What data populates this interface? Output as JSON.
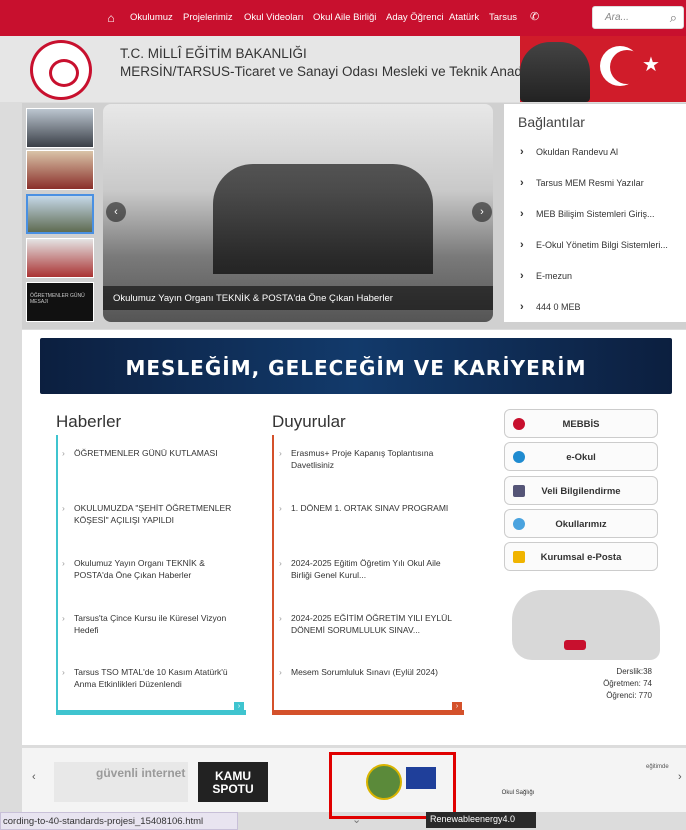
{
  "nav": {
    "home_icon": "home-icon",
    "items": [
      "Okulumuz",
      "Projelerimiz",
      "Okul Videoları",
      "Okul Aile Birliği",
      "Aday Öğrenci",
      "Atatürk",
      "Tarsus"
    ],
    "phone_icon": "phone-icon",
    "search_placeholder": "Ara...",
    "search_icon": "search-icon"
  },
  "header": {
    "title_line1": "T.C. MİLLÎ EĞİTİM BAKANLIĞI",
    "title_line2": "MERSİN/TARSUS-Ticaret ve Sanayi Odası Mesleki ve Teknik Anadolu Lisesi"
  },
  "slider": {
    "caption": "Okulumuz Yayın Organı TEKNİK & POSTA'da Öne Çıkan Haberler",
    "thumb5_text": "ÖĞRETMENLER GÜNÜ MESAJI"
  },
  "links": {
    "title": "Bağlantılar",
    "items": [
      "Okuldan Randevu Al",
      "Tarsus MEM Resmi Yazılar",
      "MEB Bilişim Sistemleri Giriş...",
      "E-Okul Yönetim Bilgi Sistemleri...",
      "E-mezun",
      "444 0 MEB"
    ]
  },
  "banner": {
    "text": "MESLEĞİM, GELECEĞİM VE KARİYERİM"
  },
  "haberler": {
    "title": "Haberler",
    "items": [
      "ÖĞRETMENLER GÜNÜ KUTLAMASI",
      "OKULUMUZDA \"ŞEHİT ÖĞRETMENLER KÖŞESİ\" AÇILIŞI YAPILDI",
      "Okulumuz Yayın Organı TEKNİK & POSTA'da Öne Çıkan Haberler",
      "Tarsus'ta Çince Kursu ile Küresel Vizyon Hedefi",
      "Tarsus TSO MTAL'de 10 Kasım Atatürk'ü Anma Etkinlikleri Düzenlendi"
    ]
  },
  "duyurular": {
    "title": "Duyurular",
    "items": [
      "Erasmus+ Proje Kapanış Toplantısına Davetlisiniz",
      "1. DÖNEM 1. ORTAK SINAV PROGRAMI",
      "2024-2025 Eğitim Öğretim Yılı Okul Aile Birliği Genel Kurul...",
      "2024-2025 EĞİTİM ÖĞRETİM YILI EYLÜL DÖNEMİ SORUMLULUK SINAV...",
      "Mesem Sorumluluk Sınavı (Eylül 2024)"
    ]
  },
  "side_buttons": [
    "MEBBİS",
    "e-Okul",
    "Veli Bilgilendirme",
    "Okullarımız",
    "Kurumsal e-Posta"
  ],
  "stats": {
    "derslik": "Derslik:38",
    "ogretmen": "Öğretmen: 74",
    "ogrenci": "Öğrenci: 770"
  },
  "footer": {
    "guvenli_internet": "güvenli internet",
    "kamu_spotu": "KAMU SPOTU",
    "egitimde": "eğitimde",
    "okul_sagligi": "Okul Sağlığı"
  },
  "status_url": "cording-to-40-standards-projesi_15408106.html",
  "tooltip": "Renewableenergy4.0"
}
